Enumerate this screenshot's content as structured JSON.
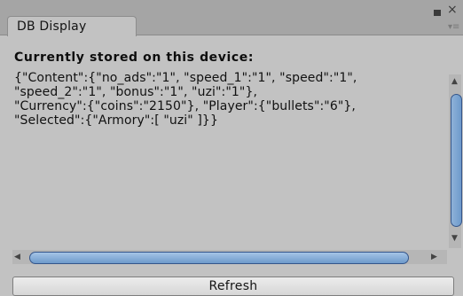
{
  "window": {
    "tab_title": "DB Display",
    "menu_icon": "kebab-menu-icon",
    "maximize_icon": "maximize-icon",
    "close_icon": "close-icon"
  },
  "content": {
    "heading": "Currently stored on this device:",
    "stored_text": "{\"Content\":{\"no_ads\":\"1\", \"speed_1\":\"1\", \"speed\":\"1\",\n\"speed_2\":\"1\", \"bonus\":\"1\", \"uzi\":\"1\"},\n\"Currency\":{\"coins\":\"2150\"}, \"Player\":{\"bullets\":\"6\"},\n\"Selected\":{\"Armory\":[ \"uzi\" ]}}"
  },
  "actions": {
    "refresh_label": "Refresh"
  }
}
